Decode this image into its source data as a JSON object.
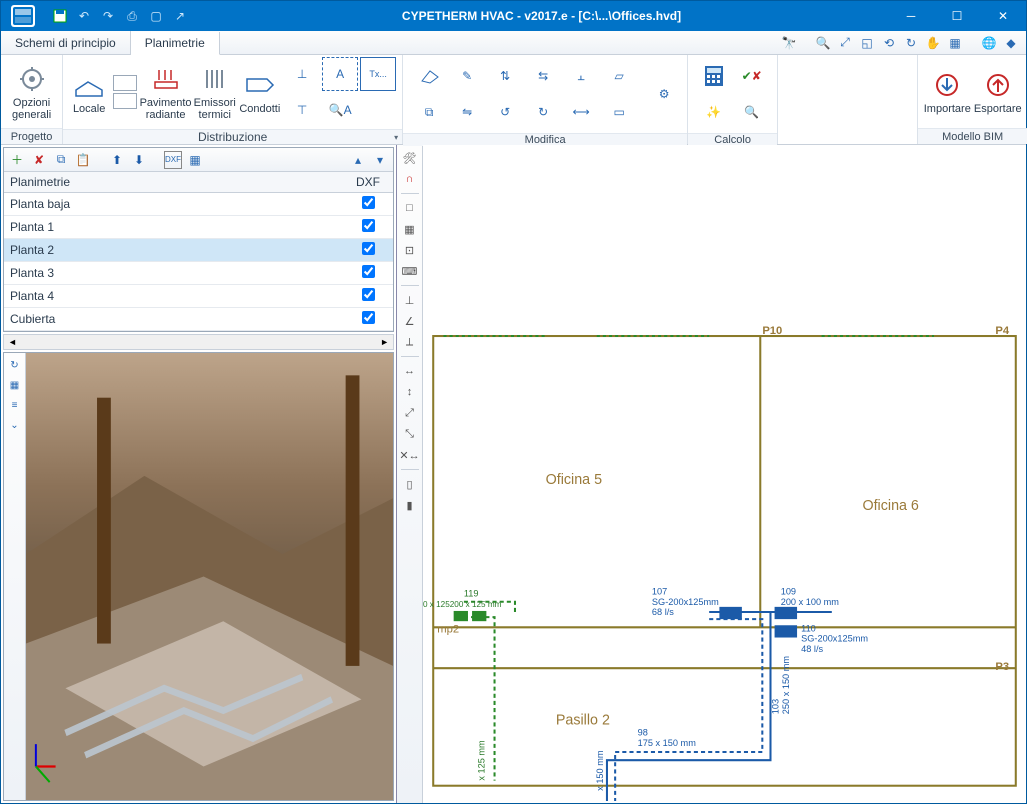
{
  "window": {
    "title": "CYPETHERM HVAC - v2017.e - [C:\\...\\Offices.hvd]"
  },
  "tabs": {
    "schemi": "Schemi di principio",
    "planimetrie": "Planimetrie"
  },
  "ribbon": {
    "progetto": {
      "label": "Progetto",
      "opzioni": "Opzioni\ngenerali"
    },
    "distribuzione": {
      "label": "Distribuzione",
      "locale": "Locale",
      "pavimento": "Pavimento\nradiante",
      "emissori": "Emissori\ntermici",
      "condotti": "Condotti"
    },
    "modifica": {
      "label": "Modifica"
    },
    "calcolo": {
      "label": "Calcolo"
    },
    "bim": {
      "label": "Modello BIM",
      "importare": "Importare",
      "esportare": "Esportare"
    }
  },
  "planimetrie_panel": {
    "header_name": "Planimetrie",
    "header_dxf": "DXF",
    "rows": [
      {
        "name": "Planta baja",
        "dxf": true
      },
      {
        "name": "Planta 1",
        "dxf": true
      },
      {
        "name": "Planta 2",
        "dxf": true,
        "selected": true
      },
      {
        "name": "Planta 3",
        "dxf": true
      },
      {
        "name": "Planta 4",
        "dxf": true
      },
      {
        "name": "Cubierta",
        "dxf": true
      }
    ]
  },
  "floorplan": {
    "rooms": {
      "oficina5": "Oficina 5",
      "oficina6": "Oficina 6",
      "pasillo2": "Pasillo 2",
      "mp2": "mp2"
    },
    "pillars": {
      "p10": "P10",
      "p3": "P3",
      "p4": "P4"
    },
    "annotations": {
      "a1": "119",
      "a2": "0 x 125200 x 125 mm",
      "a3": "107",
      "a4": "SG-200x125mm",
      "a5": "68 l/s",
      "a6": "109",
      "a7": "200 x 100 mm",
      "a8": "110",
      "a9": "SG-200x125mm",
      "a10": "48 l/s",
      "a11": "103",
      "a12": "250 x 150 mm",
      "a13": "98",
      "a14": "175 x 150 mm",
      "a15": "x 150 mm",
      "a16": "x 125 mm"
    }
  }
}
